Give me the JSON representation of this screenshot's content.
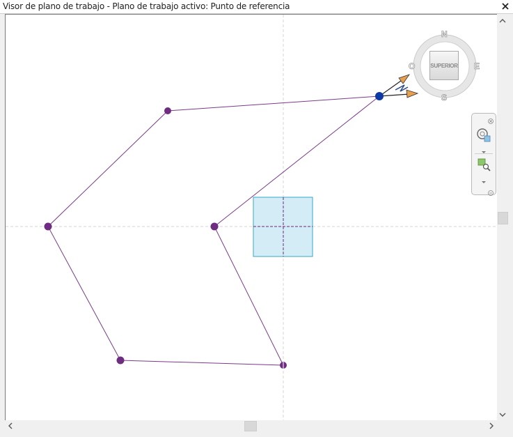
{
  "window": {
    "title": "Visor de plano de trabajo - Plano de trabajo activo: Punto de referencia"
  },
  "viewcube": {
    "face_label": "SUPERIOR",
    "compass": {
      "north": "N",
      "south": "S",
      "east": "E",
      "west": "O"
    }
  },
  "colors": {
    "geometry": "#6b2a7b",
    "selected_point": "#0b3aa5",
    "workplane_fill": "#d3ebf5",
    "workplane_border": "#33a7c9",
    "axis_dash": "#d0d0d0",
    "arrow": "#e8a050"
  }
}
